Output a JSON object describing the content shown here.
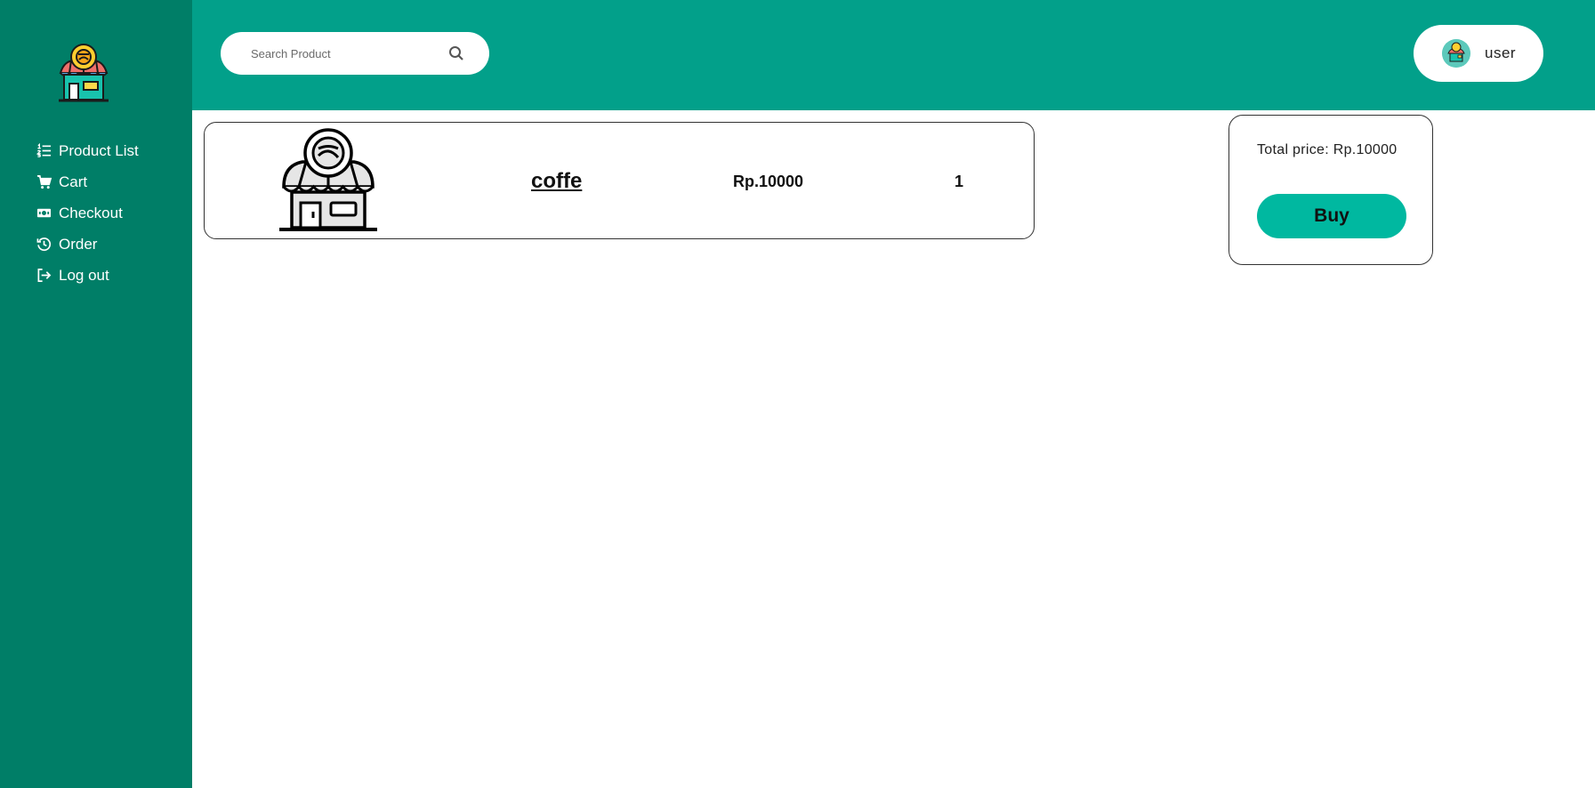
{
  "sidebar": {
    "logo_icon": "shop-logo-icon",
    "items": [
      {
        "label": "Product List",
        "icon": "list-icon"
      },
      {
        "label": "Cart",
        "icon": "cart-icon"
      },
      {
        "label": "Checkout",
        "icon": "money-icon"
      },
      {
        "label": "Order",
        "icon": "history-icon"
      },
      {
        "label": "Log out",
        "icon": "logout-icon"
      }
    ]
  },
  "header": {
    "search": {
      "placeholder": "Search Product",
      "value": ""
    },
    "user": {
      "name": "user"
    }
  },
  "cart": {
    "items": [
      {
        "name": "coffe",
        "price": "Rp.10000",
        "quantity": "1",
        "image_icon": "store-icon"
      }
    ]
  },
  "summary": {
    "total_label": "Total price: Rp.10000",
    "buy_label": "Buy"
  },
  "colors": {
    "sidebar": "#007e67",
    "header": "#02a08a",
    "buy_button": "#00b8a0"
  }
}
